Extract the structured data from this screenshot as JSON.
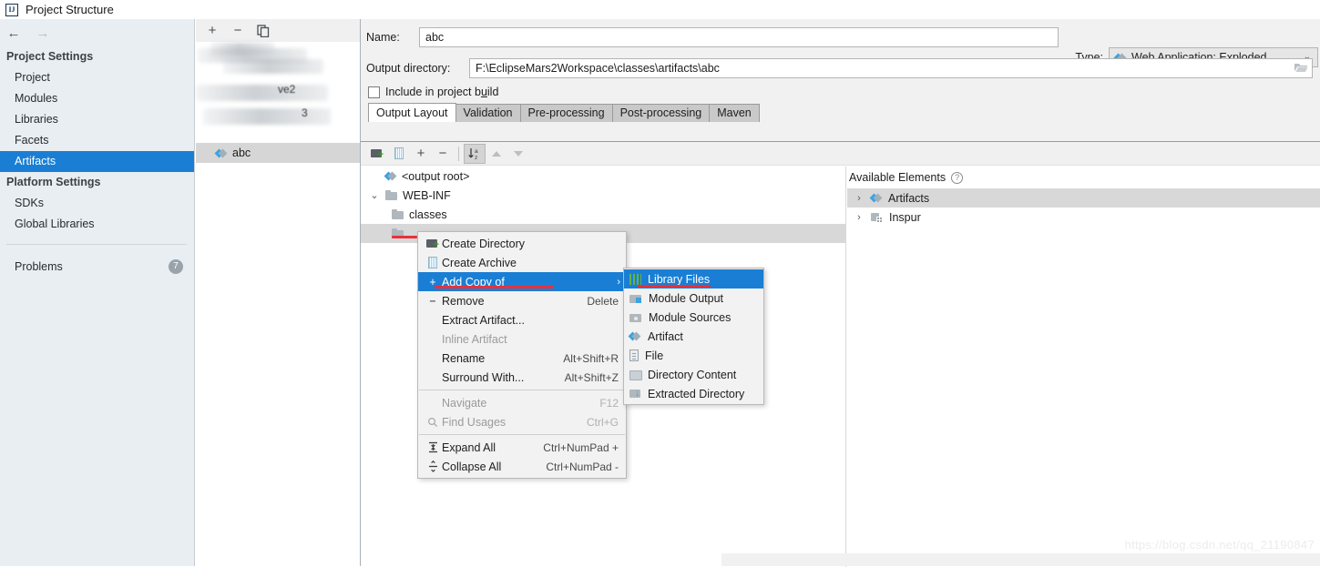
{
  "window": {
    "title": "Project Structure",
    "app_icon": "intellij-idea-icon"
  },
  "sidebar": {
    "back_icon": "arrow-left-icon",
    "forward_icon": "arrow-right-icon",
    "groups": [
      {
        "title": "Project Settings",
        "items": [
          {
            "label": "Project",
            "selected": false
          },
          {
            "label": "Modules",
            "selected": false
          },
          {
            "label": "Libraries",
            "selected": false
          },
          {
            "label": "Facets",
            "selected": false
          },
          {
            "label": "Artifacts",
            "selected": true
          }
        ]
      },
      {
        "title": "Platform Settings",
        "items": [
          {
            "label": "SDKs",
            "selected": false
          },
          {
            "label": "Global Libraries",
            "selected": false
          }
        ]
      }
    ],
    "problems": {
      "label": "Problems",
      "count": "7"
    },
    "selected_color": "#1a7fd4"
  },
  "artifact_panel": {
    "toolbar": [
      {
        "name": "add-artifact-button",
        "glyph": "+"
      },
      {
        "name": "remove-artifact-button",
        "glyph": "−"
      },
      {
        "name": "copy-artifact-button",
        "glyph": "❐"
      }
    ],
    "items": [
      {
        "label": "",
        "redacted": true
      },
      {
        "label": "ve2",
        "redacted": true
      },
      {
        "label": "3",
        "redacted": true
      },
      {
        "label": "abc",
        "redacted": false,
        "selected": true,
        "icon": "artifact-icon"
      }
    ]
  },
  "form": {
    "name_label": "Name:",
    "name_value": "abc",
    "type_label": "Type:",
    "type_value": "Web Application: Exploded",
    "type_icon": "artifact-icon",
    "type_chevron": "chevron-down-icon",
    "output_dir_label": "Output directory:",
    "output_dir_value": "F:\\EclipseMars2Workspace\\classes\\artifacts\\abc",
    "browse_icon": "folder-open-icon",
    "include_checkbox_label_pre": "Include in project b",
    "include_checkbox_label_u": "u",
    "include_checkbox_label_post": "ild",
    "include_checked": false
  },
  "tabs": [
    {
      "label": "Output Layout",
      "active": true
    },
    {
      "label": "Validation",
      "active": false
    },
    {
      "label": "Pre-processing",
      "active": false
    },
    {
      "label": "Post-processing",
      "active": false
    },
    {
      "label": "Maven",
      "active": false
    }
  ],
  "layout_toolbar": [
    {
      "name": "create-directory-button",
      "icon": "folder-add-icon"
    },
    {
      "name": "create-archive-button",
      "icon": "archive-icon"
    },
    {
      "name": "add-copy-button",
      "icon": "plus-dropdown-icon"
    },
    {
      "name": "remove-button",
      "icon": "minus-icon"
    },
    {
      "name": "sort-alphabetically-button",
      "icon": "sort-az-icon",
      "pressed": true
    },
    {
      "name": "move-up-button",
      "icon": "triangle-up-icon"
    },
    {
      "name": "move-down-button",
      "icon": "triangle-down-icon"
    }
  ],
  "output_tree": [
    {
      "label": "<output root>",
      "indent": 0,
      "icon": "artifact-icon",
      "twisty": ""
    },
    {
      "label": "WEB-INF",
      "indent": 1,
      "icon": "folder-icon",
      "twisty": "⌄"
    },
    {
      "label": "classes",
      "indent": 2,
      "icon": "folder-icon",
      "twisty": ""
    },
    {
      "label": "",
      "indent": 2,
      "icon": "folder-icon",
      "twisty": "",
      "selected": true
    }
  ],
  "available_elements": {
    "header": "Available Elements",
    "help_icon": "question-mark-icon",
    "rows": [
      {
        "label": "Artifacts",
        "icon": "artifact-icon",
        "twisty": "›",
        "highlighted": true
      },
      {
        "label": "Inspur",
        "icon": "module-icon",
        "twisty": "›",
        "highlighted": false
      }
    ]
  },
  "context_menu": {
    "items": [
      {
        "label": "Create Directory",
        "accel": "",
        "icon": "folder-add-icon",
        "state": "normal"
      },
      {
        "label": "Create Archive",
        "accel": "",
        "icon": "archive-icon",
        "state": "normal"
      },
      {
        "label": "Add Copy of",
        "accel": "",
        "icon": "plus-icon",
        "state": "highlighted",
        "submenu": true
      },
      {
        "label": "Remove",
        "accel": "Delete",
        "icon": "minus-icon",
        "state": "normal"
      },
      {
        "label": "Extract Artifact...",
        "accel": "",
        "icon": "",
        "state": "normal"
      },
      {
        "label": "Inline Artifact",
        "accel": "",
        "icon": "",
        "state": "disabled"
      },
      {
        "label": "Rename",
        "accel": "Alt+Shift+R",
        "icon": "",
        "state": "normal"
      },
      {
        "label": "Surround With...",
        "accel": "Alt+Shift+Z",
        "icon": "",
        "state": "normal"
      },
      {
        "separator": true
      },
      {
        "label": "Navigate",
        "accel": "F12",
        "icon": "",
        "state": "disabled"
      },
      {
        "label": "Find Usages",
        "accel": "Ctrl+G",
        "icon": "search-icon",
        "state": "disabled"
      },
      {
        "separator": true
      },
      {
        "label": "Expand All",
        "accel": "Ctrl+NumPad +",
        "icon": "expand-all-icon",
        "state": "normal"
      },
      {
        "label": "Collapse All",
        "accel": "Ctrl+NumPad -",
        "icon": "collapse-all-icon",
        "state": "normal"
      }
    ]
  },
  "submenu": {
    "items": [
      {
        "label": "Library Files",
        "icon": "library-files-icon",
        "highlighted": true
      },
      {
        "label": "Module Output",
        "icon": "module-output-icon",
        "highlighted": false
      },
      {
        "label": "Module Sources",
        "icon": "module-sources-icon",
        "highlighted": false
      },
      {
        "label": "Artifact",
        "icon": "artifact-icon",
        "highlighted": false
      },
      {
        "label": "File",
        "icon": "file-icon",
        "highlighted": false
      },
      {
        "label": "Directory Content",
        "icon": "directory-content-icon",
        "highlighted": false
      },
      {
        "label": "Extracted Directory",
        "icon": "extracted-directory-icon",
        "highlighted": false
      }
    ]
  },
  "annotations": {
    "color": "#e8313a",
    "marks": [
      "underline-add-copy-of",
      "underline-library-files",
      "underline-tree-row"
    ]
  },
  "watermark": "https://blog.csdn.net/qq_21190847"
}
